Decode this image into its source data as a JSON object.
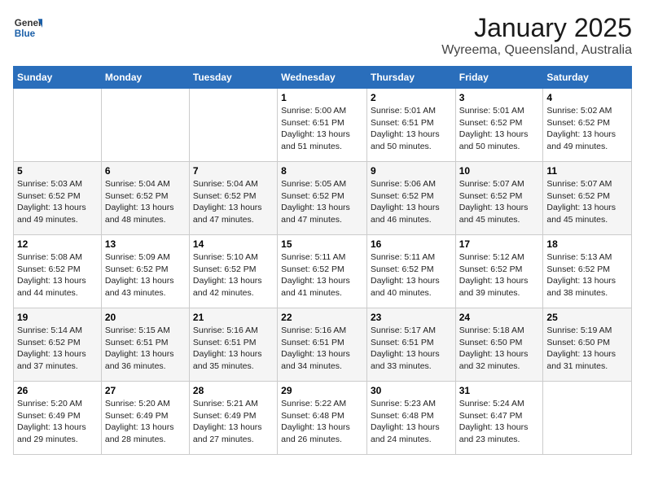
{
  "header": {
    "logo_general": "General",
    "logo_blue": "Blue",
    "title": "January 2025",
    "subtitle": "Wyreema, Queensland, Australia"
  },
  "calendar": {
    "days_of_week": [
      "Sunday",
      "Monday",
      "Tuesday",
      "Wednesday",
      "Thursday",
      "Friday",
      "Saturday"
    ],
    "weeks": [
      [
        {
          "day": "",
          "info": ""
        },
        {
          "day": "",
          "info": ""
        },
        {
          "day": "",
          "info": ""
        },
        {
          "day": "1",
          "info": "Sunrise: 5:00 AM\nSunset: 6:51 PM\nDaylight: 13 hours\nand 51 minutes."
        },
        {
          "day": "2",
          "info": "Sunrise: 5:01 AM\nSunset: 6:51 PM\nDaylight: 13 hours\nand 50 minutes."
        },
        {
          "day": "3",
          "info": "Sunrise: 5:01 AM\nSunset: 6:52 PM\nDaylight: 13 hours\nand 50 minutes."
        },
        {
          "day": "4",
          "info": "Sunrise: 5:02 AM\nSunset: 6:52 PM\nDaylight: 13 hours\nand 49 minutes."
        }
      ],
      [
        {
          "day": "5",
          "info": "Sunrise: 5:03 AM\nSunset: 6:52 PM\nDaylight: 13 hours\nand 49 minutes."
        },
        {
          "day": "6",
          "info": "Sunrise: 5:04 AM\nSunset: 6:52 PM\nDaylight: 13 hours\nand 48 minutes."
        },
        {
          "day": "7",
          "info": "Sunrise: 5:04 AM\nSunset: 6:52 PM\nDaylight: 13 hours\nand 47 minutes."
        },
        {
          "day": "8",
          "info": "Sunrise: 5:05 AM\nSunset: 6:52 PM\nDaylight: 13 hours\nand 47 minutes."
        },
        {
          "day": "9",
          "info": "Sunrise: 5:06 AM\nSunset: 6:52 PM\nDaylight: 13 hours\nand 46 minutes."
        },
        {
          "day": "10",
          "info": "Sunrise: 5:07 AM\nSunset: 6:52 PM\nDaylight: 13 hours\nand 45 minutes."
        },
        {
          "day": "11",
          "info": "Sunrise: 5:07 AM\nSunset: 6:52 PM\nDaylight: 13 hours\nand 45 minutes."
        }
      ],
      [
        {
          "day": "12",
          "info": "Sunrise: 5:08 AM\nSunset: 6:52 PM\nDaylight: 13 hours\nand 44 minutes."
        },
        {
          "day": "13",
          "info": "Sunrise: 5:09 AM\nSunset: 6:52 PM\nDaylight: 13 hours\nand 43 minutes."
        },
        {
          "day": "14",
          "info": "Sunrise: 5:10 AM\nSunset: 6:52 PM\nDaylight: 13 hours\nand 42 minutes."
        },
        {
          "day": "15",
          "info": "Sunrise: 5:11 AM\nSunset: 6:52 PM\nDaylight: 13 hours\nand 41 minutes."
        },
        {
          "day": "16",
          "info": "Sunrise: 5:11 AM\nSunset: 6:52 PM\nDaylight: 13 hours\nand 40 minutes."
        },
        {
          "day": "17",
          "info": "Sunrise: 5:12 AM\nSunset: 6:52 PM\nDaylight: 13 hours\nand 39 minutes."
        },
        {
          "day": "18",
          "info": "Sunrise: 5:13 AM\nSunset: 6:52 PM\nDaylight: 13 hours\nand 38 minutes."
        }
      ],
      [
        {
          "day": "19",
          "info": "Sunrise: 5:14 AM\nSunset: 6:52 PM\nDaylight: 13 hours\nand 37 minutes."
        },
        {
          "day": "20",
          "info": "Sunrise: 5:15 AM\nSunset: 6:51 PM\nDaylight: 13 hours\nand 36 minutes."
        },
        {
          "day": "21",
          "info": "Sunrise: 5:16 AM\nSunset: 6:51 PM\nDaylight: 13 hours\nand 35 minutes."
        },
        {
          "day": "22",
          "info": "Sunrise: 5:16 AM\nSunset: 6:51 PM\nDaylight: 13 hours\nand 34 minutes."
        },
        {
          "day": "23",
          "info": "Sunrise: 5:17 AM\nSunset: 6:51 PM\nDaylight: 13 hours\nand 33 minutes."
        },
        {
          "day": "24",
          "info": "Sunrise: 5:18 AM\nSunset: 6:50 PM\nDaylight: 13 hours\nand 32 minutes."
        },
        {
          "day": "25",
          "info": "Sunrise: 5:19 AM\nSunset: 6:50 PM\nDaylight: 13 hours\nand 31 minutes."
        }
      ],
      [
        {
          "day": "26",
          "info": "Sunrise: 5:20 AM\nSunset: 6:49 PM\nDaylight: 13 hours\nand 29 minutes."
        },
        {
          "day": "27",
          "info": "Sunrise: 5:20 AM\nSunset: 6:49 PM\nDaylight: 13 hours\nand 28 minutes."
        },
        {
          "day": "28",
          "info": "Sunrise: 5:21 AM\nSunset: 6:49 PM\nDaylight: 13 hours\nand 27 minutes."
        },
        {
          "day": "29",
          "info": "Sunrise: 5:22 AM\nSunset: 6:48 PM\nDaylight: 13 hours\nand 26 minutes."
        },
        {
          "day": "30",
          "info": "Sunrise: 5:23 AM\nSunset: 6:48 PM\nDaylight: 13 hours\nand 24 minutes."
        },
        {
          "day": "31",
          "info": "Sunrise: 5:24 AM\nSunset: 6:47 PM\nDaylight: 13 hours\nand 23 minutes."
        },
        {
          "day": "",
          "info": ""
        }
      ]
    ]
  }
}
